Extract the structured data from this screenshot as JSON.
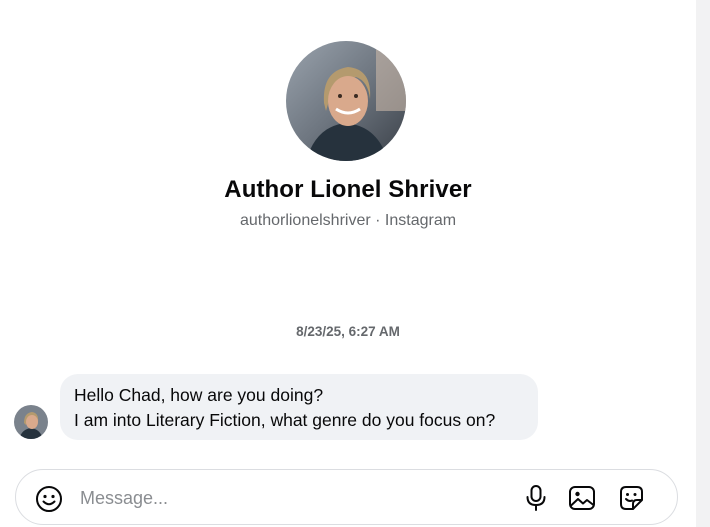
{
  "profile": {
    "name": "Author Lionel Shriver",
    "subtitle": "authorlionelshriver · Instagram",
    "avatar_icon": "profile-photo-avatar"
  },
  "thread": {
    "timestamp": "8/23/25, 6:27 AM",
    "messages": [
      {
        "sender": "Author Lionel Shriver",
        "lines": [
          "Hello Chad, how are you doing?",
          "I am into Literary Fiction, what genre do you focus on?"
        ]
      }
    ]
  },
  "composer": {
    "placeholder": "Message...",
    "icons": [
      "emoji-icon",
      "microphone-icon",
      "image-icon",
      "sticker-icon"
    ]
  },
  "colors": {
    "bubble_bg": "#f0f2f5",
    "secondary_text": "#65686c",
    "primary_text": "#080809"
  }
}
